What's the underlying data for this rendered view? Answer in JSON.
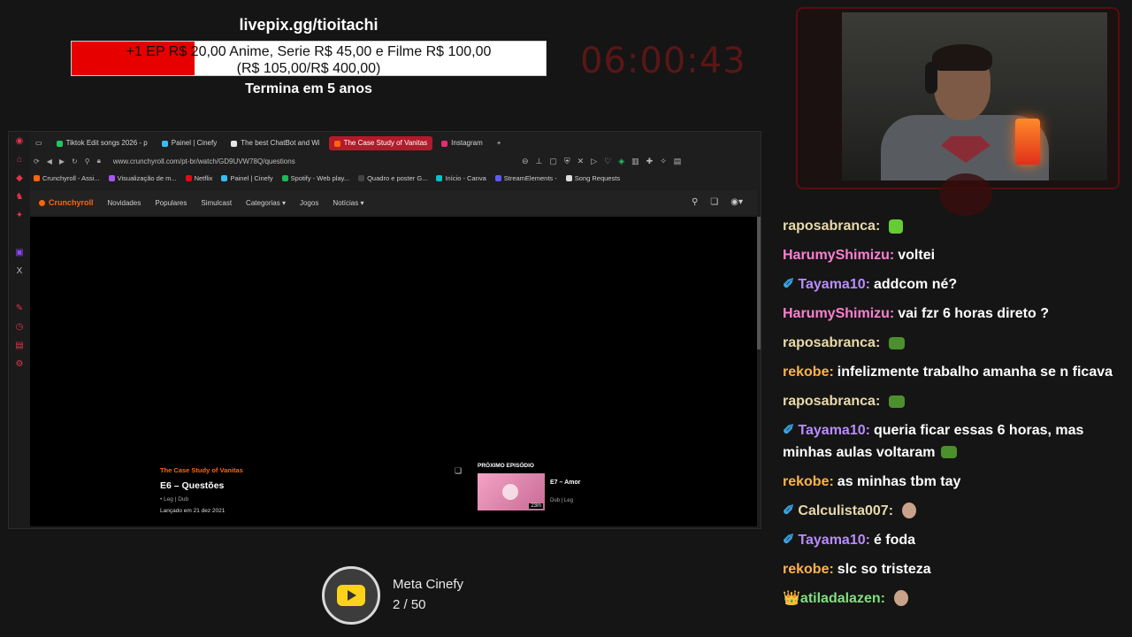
{
  "overlay": {
    "pix_url": "livepix.gg/tioitachi",
    "goal_line1": "+1 EP R$ 20,00 Anime, Serie R$ 45,00 e Filme R$ 100,00",
    "goal_line2": "(R$ 105,00/R$ 400,00)",
    "goal_progress": 0.26,
    "goal_end": "Termina em 5 anos",
    "timer": "06:00:43"
  },
  "browser": {
    "tabs": [
      {
        "label": "Tiktok Edit songs 2026 - p",
        "color": "#22c55e"
      },
      {
        "label": "Painel | Cinefy",
        "color": "#38bdf8"
      },
      {
        "label": "The best ChatBot and Wi",
        "color": "#e5e5e5"
      },
      {
        "label": "The Case Study of Vanitas",
        "color": "#ff640a"
      },
      {
        "label": "Instagram",
        "color": "#e1306c"
      }
    ],
    "url": "www.crunchyroll.com/pt-br/watch/GD9UVW78Q/questions",
    "bookmarks": [
      "Crunchyroll - Assi...",
      "Visualização de m...",
      "Netflix",
      "Painel | Cinefy",
      "Spotify - Web play...",
      "Quadro e poster G...",
      "Início - Canva",
      "StreamElements -",
      "Song Requests"
    ],
    "site": {
      "logo": "Crunchyroll",
      "nav": [
        "Novidades",
        "Populares",
        "Simulcast",
        "Categorias",
        "Jogos",
        "Notícias"
      ]
    },
    "episode": {
      "series": "The Case Study of Vanitas",
      "title": "E6 – Questões",
      "meta": "• Leg | Dub",
      "date": "Lançado em 21 dez 2021"
    },
    "next": {
      "heading": "PRÓXIMO EPISÓDIO",
      "title": "E7 – Amor",
      "meta": "Dub | Leg",
      "duration": "23m"
    }
  },
  "goal_widget": {
    "title": "Meta Cinefy",
    "count": "2 / 50"
  },
  "chat": [
    {
      "user": "raposabranca:",
      "color": "#e8d9a8",
      "text": "",
      "emote": "green"
    },
    {
      "user": "HarumyShimizu:",
      "color": "#ff7fd0",
      "text": "voltei"
    },
    {
      "user": "Tayama10:",
      "color": "#b98cff",
      "text": "addcom né?",
      "badge": "✐"
    },
    {
      "user": "HarumyShimizu:",
      "color": "#ff7fd0",
      "text": "vai fzr 6 horas direto ?"
    },
    {
      "user": "raposabranca:",
      "color": "#e8d9a8",
      "text": "",
      "emote": "pepe"
    },
    {
      "user": "rekobe:",
      "color": "#ffb347",
      "text": "infelizmente trabalho amanha se n ficava"
    },
    {
      "user": "raposabranca:",
      "color": "#e8d9a8",
      "text": "",
      "emote": "pepe"
    },
    {
      "user": "Tayama10:",
      "color": "#b98cff",
      "text": "queria ficar essas 6 horas, mas minhas aulas voltaram",
      "badge": "✐",
      "emote": "pepe"
    },
    {
      "user": "rekobe:",
      "color": "#ffb347",
      "text": "as minhas tbm tay"
    },
    {
      "user": "Calculista007:",
      "color": "#e8d9a8",
      "text": "",
      "badge": "✐",
      "emote": "face"
    },
    {
      "user": "Tayama10:",
      "color": "#b98cff",
      "text": "é foda",
      "badge": "✐"
    },
    {
      "user": "rekobe:",
      "color": "#ffb347",
      "text": "slc so tristeza"
    },
    {
      "user": "atiladalazen:",
      "color": "#7ee07e",
      "text": "",
      "badge": "👑",
      "emote": "face"
    }
  ]
}
